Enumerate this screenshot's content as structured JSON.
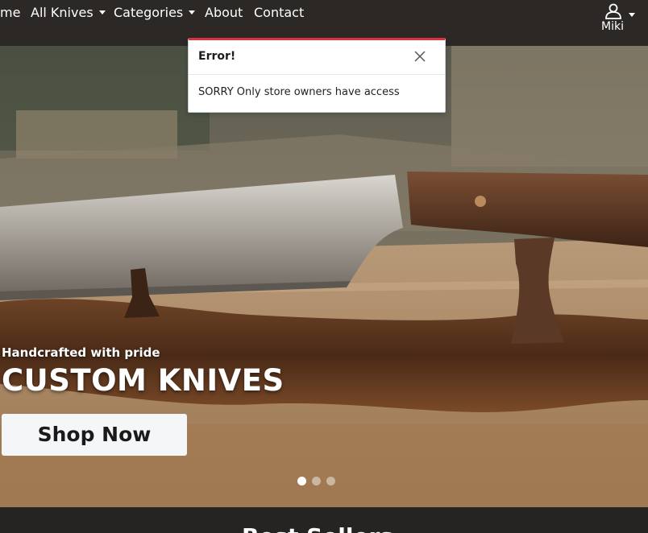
{
  "navbar": {
    "items": [
      {
        "label": "me",
        "caret": false
      },
      {
        "label": "All Knives",
        "caret": true
      },
      {
        "label": "Categories",
        "caret": true
      },
      {
        "label": "About",
        "caret": false
      },
      {
        "label": "Contact",
        "caret": false
      }
    ],
    "user": {
      "label": "Miki",
      "icon": "user-icon"
    }
  },
  "toast": {
    "title": "Error!",
    "message": "SORRY Only store owners have access",
    "close_icon": "close-icon",
    "accent": "#d8353f"
  },
  "hero": {
    "tagline": "Handcrafted with pride",
    "headline": "CUSTOM KNIVES",
    "cta_label": "Shop Now",
    "slides": 3,
    "active_slide": 1
  },
  "bottom": {
    "title_partial": "Best Sellers"
  },
  "colors": {
    "navbar_bg": "#2c2826",
    "button_bg": "#f5f6f8",
    "error_accent": "#d8353f"
  }
}
